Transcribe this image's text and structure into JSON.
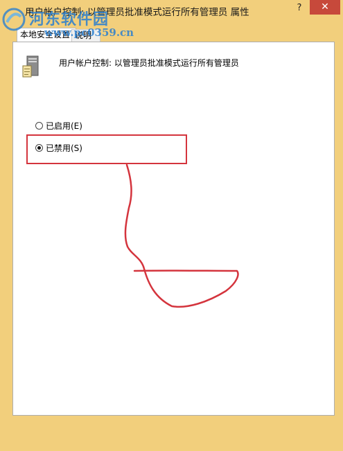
{
  "window": {
    "title": "用户帐户控制: 以管理员批准模式运行所有管理员 属性",
    "help_label": "?",
    "close_label": "✕"
  },
  "watermark": {
    "name": "河东软件园",
    "url": "www.pc0359.cn"
  },
  "tabs": [
    {
      "label": "本地安全设置",
      "active": true
    },
    {
      "label": "说明",
      "active": false
    }
  ],
  "policy": {
    "icon": "server-icon",
    "name": "用户帐户控制: 以管理员批准模式运行所有管理员"
  },
  "options": [
    {
      "label": "已启用(E)",
      "checked": false
    },
    {
      "label": "已禁用(S)",
      "checked": true
    }
  ],
  "colors": {
    "frame": "#f2cf7c",
    "close_button": "#c7493b",
    "annotation": "#d4343d",
    "watermark": "#2a7fd0"
  }
}
